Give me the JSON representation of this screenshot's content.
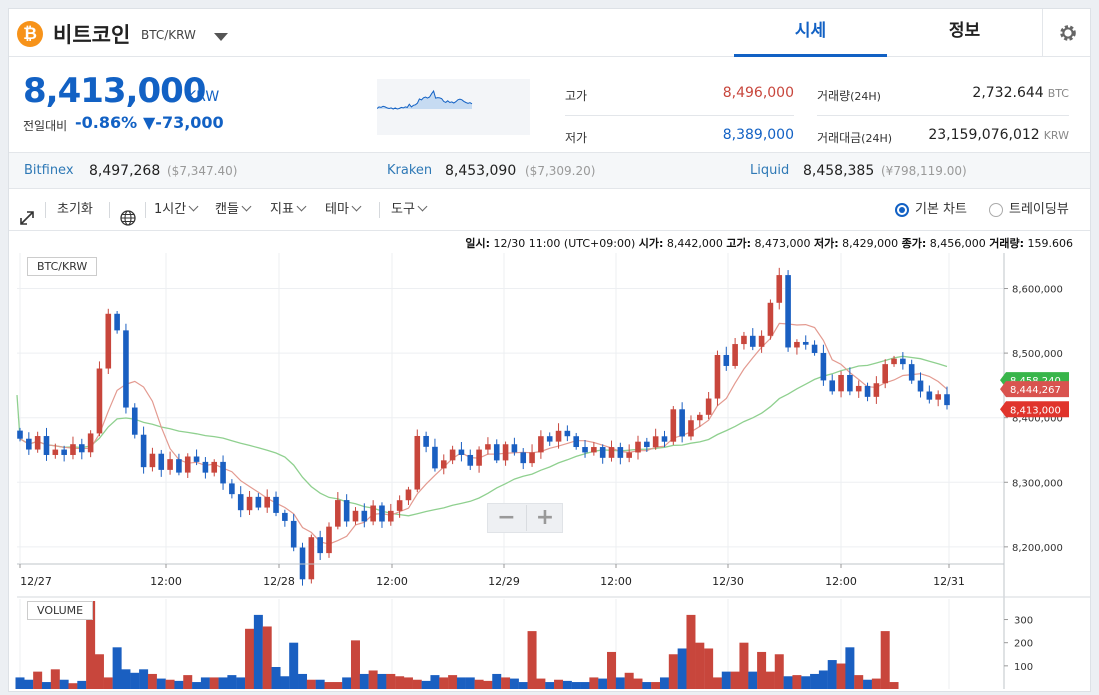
{
  "header": {
    "coin_name": "비트코인",
    "pair": "BTC/KRW",
    "tabs": [
      "시세",
      "정보"
    ],
    "colors": {
      "accent": "#1261c4",
      "up": "#c8463c",
      "down": "#1261c4",
      "btc": "#f7931a"
    }
  },
  "price": {
    "value": "8,413,000",
    "unit": "KRW",
    "change_label": "전일대비",
    "change_rate": "-0.86%",
    "change_amount": "▼-73,000"
  },
  "stats": {
    "high_label": "고가",
    "high": "8,496,000",
    "low_label": "저가",
    "low": "8,389,000",
    "vol_label": "거래량",
    "vol_period": "(24H)",
    "vol": "2,732.644",
    "vol_unit": "BTC",
    "amt_label": "거래대금",
    "amt_period": "(24H)",
    "amt": "23,159,076,012",
    "amt_unit": "KRW"
  },
  "exchanges": [
    {
      "name": "Bitfinex",
      "price": "8,497,268",
      "alt": "($7,347.40)"
    },
    {
      "name": "Kraken",
      "price": "8,453,090",
      "alt": "($7,309.20)"
    },
    {
      "name": "Liquid",
      "price": "8,458,385",
      "alt": "(¥798,119.00)"
    }
  ],
  "toolbar": {
    "reset": "초기화",
    "interval": "1시간",
    "candle": "캔들",
    "indicator": "지표",
    "theme": "테마",
    "tools": "도구",
    "basic_chart": "기본 차트",
    "trading_view": "트레이딩뷰"
  },
  "ohlc": {
    "date_label": "일시:",
    "date": "12/30 11:00 (UTC+09:00)",
    "open_label": "시가:",
    "open": "8,442,000",
    "high_label": "고가:",
    "high": "8,473,000",
    "low_label": "저가:",
    "low": "8,429,000",
    "close_label": "종가:",
    "close": "8,456,000",
    "volume_label": "거래량:",
    "volume": "159.606"
  },
  "chart_data": {
    "type": "candlestick",
    "title": "BTC/KRW",
    "volume_title": "VOLUME",
    "x_tick_labels": [
      "12/27",
      "12:00",
      "12/28",
      "12:00",
      "12/29",
      "12:00",
      "12/30",
      "12:00",
      "12/31"
    ],
    "y_ticks": [
      8200000,
      8300000,
      8400000,
      8500000,
      8600000
    ],
    "y_tick_labels": [
      "8,200,000",
      "8,300,000",
      "8,400,000",
      "8,500,000",
      "8,600,000"
    ],
    "ylim": [
      8175000,
      8655000
    ],
    "volume_ticks": [
      100,
      200,
      300
    ],
    "volume_ylim": [
      0,
      380
    ],
    "price_tags": [
      {
        "value": 8458240,
        "label": "8,458,240",
        "color": "#38b54a"
      },
      {
        "value": 8444267,
        "label": "8,444,267",
        "color": "#d9534f"
      },
      {
        "value": 8413000,
        "label": "8,413,000",
        "color": "#e0342c"
      }
    ],
    "start_close": 8380000,
    "candles_pct": [
      -0.15,
      -0.2,
      0.25,
      -0.35,
      0.1,
      -0.1,
      0.2,
      -0.15,
      0.35,
      1.2,
      1.0,
      -0.3,
      -1.4,
      -0.5,
      -0.6,
      0.25,
      -0.3,
      0.2,
      -0.25,
      0.3,
      -0.1,
      -0.2,
      0.2,
      -0.4,
      -0.2,
      -0.3,
      0.25,
      -0.2,
      0.2,
      -0.3,
      -0.15,
      -0.5,
      -0.6,
      0.8,
      -0.3,
      0.5,
      0.5,
      -0.4,
      0.2,
      -0.2,
      0.3,
      -0.3,
      0.2,
      0.2,
      0.2,
      1.0,
      -0.2,
      -0.4,
      0.15,
      0.2,
      -0.1,
      -0.2,
      0.3,
      0.1,
      -0.3,
      0.3,
      -0.15,
      -0.2,
      0.2,
      0.3,
      -0.1,
      0.2,
      -0.1,
      -0.2,
      -0.1,
      0.1,
      -0.2,
      0.2,
      -0.2,
      0.1,
      0.2,
      -0.1,
      0.2,
      -0.1,
      0.6,
      -0.5,
      0.3,
      0.1,
      0.3,
      0.8,
      -0.2,
      0.4,
      0.15,
      -0.2,
      0.2,
      0.6,
      0.5,
      -1.3,
      0.1,
      -0.05,
      -0.15,
      -0.5,
      -0.2,
      0.3,
      -0.3,
      0.1,
      -0.2,
      0.25,
      0.35,
      0.1,
      -0.1,
      -0.3,
      -0.2,
      -0.15,
      0.1,
      -0.2
    ],
    "volumes": [
      50,
      40,
      75,
      30,
      85,
      40,
      25,
      35,
      380,
      150,
      50,
      180,
      85,
      70,
      85,
      65,
      45,
      40,
      35,
      60,
      30,
      50,
      50,
      50,
      60,
      50,
      260,
      320,
      270,
      95,
      55,
      200,
      65,
      40,
      40,
      30,
      30,
      50,
      210,
      65,
      80,
      65,
      65,
      55,
      50,
      40,
      35,
      60,
      50,
      60,
      50,
      50,
      40,
      35,
      65,
      50,
      45,
      30,
      250,
      45,
      30,
      40,
      35,
      30,
      30,
      50,
      45,
      160,
      50,
      70,
      45,
      30,
      30,
      50,
      150,
      175,
      320,
      200,
      175,
      50,
      75,
      75,
      200,
      75,
      160,
      75,
      150,
      55,
      60,
      55,
      65,
      80,
      125,
      110,
      180,
      60,
      40,
      45,
      250,
      30
    ],
    "ma_fast_period": 6,
    "ma_slow_period": 22
  }
}
